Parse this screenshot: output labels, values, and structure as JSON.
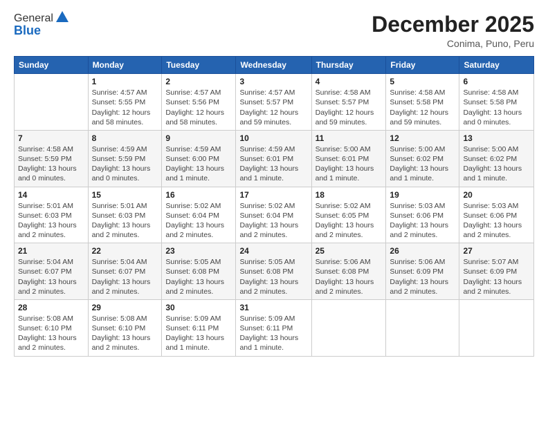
{
  "header": {
    "logo": {
      "line1": "General",
      "line2": "Blue"
    },
    "title": "December 2025",
    "location": "Conima, Puno, Peru"
  },
  "calendar": {
    "days_of_week": [
      "Sunday",
      "Monday",
      "Tuesday",
      "Wednesday",
      "Thursday",
      "Friday",
      "Saturday"
    ],
    "weeks": [
      [
        {
          "day": "",
          "info": ""
        },
        {
          "day": "1",
          "info": "Sunrise: 4:57 AM\nSunset: 5:55 PM\nDaylight: 12 hours\nand 58 minutes."
        },
        {
          "day": "2",
          "info": "Sunrise: 4:57 AM\nSunset: 5:56 PM\nDaylight: 12 hours\nand 58 minutes."
        },
        {
          "day": "3",
          "info": "Sunrise: 4:57 AM\nSunset: 5:57 PM\nDaylight: 12 hours\nand 59 minutes."
        },
        {
          "day": "4",
          "info": "Sunrise: 4:58 AM\nSunset: 5:57 PM\nDaylight: 12 hours\nand 59 minutes."
        },
        {
          "day": "5",
          "info": "Sunrise: 4:58 AM\nSunset: 5:58 PM\nDaylight: 12 hours\nand 59 minutes."
        },
        {
          "day": "6",
          "info": "Sunrise: 4:58 AM\nSunset: 5:58 PM\nDaylight: 13 hours\nand 0 minutes."
        }
      ],
      [
        {
          "day": "7",
          "info": "Sunrise: 4:58 AM\nSunset: 5:59 PM\nDaylight: 13 hours\nand 0 minutes."
        },
        {
          "day": "8",
          "info": "Sunrise: 4:59 AM\nSunset: 5:59 PM\nDaylight: 13 hours\nand 0 minutes."
        },
        {
          "day": "9",
          "info": "Sunrise: 4:59 AM\nSunset: 6:00 PM\nDaylight: 13 hours\nand 1 minute."
        },
        {
          "day": "10",
          "info": "Sunrise: 4:59 AM\nSunset: 6:01 PM\nDaylight: 13 hours\nand 1 minute."
        },
        {
          "day": "11",
          "info": "Sunrise: 5:00 AM\nSunset: 6:01 PM\nDaylight: 13 hours\nand 1 minute."
        },
        {
          "day": "12",
          "info": "Sunrise: 5:00 AM\nSunset: 6:02 PM\nDaylight: 13 hours\nand 1 minute."
        },
        {
          "day": "13",
          "info": "Sunrise: 5:00 AM\nSunset: 6:02 PM\nDaylight: 13 hours\nand 1 minute."
        }
      ],
      [
        {
          "day": "14",
          "info": "Sunrise: 5:01 AM\nSunset: 6:03 PM\nDaylight: 13 hours\nand 2 minutes."
        },
        {
          "day": "15",
          "info": "Sunrise: 5:01 AM\nSunset: 6:03 PM\nDaylight: 13 hours\nand 2 minutes."
        },
        {
          "day": "16",
          "info": "Sunrise: 5:02 AM\nSunset: 6:04 PM\nDaylight: 13 hours\nand 2 minutes."
        },
        {
          "day": "17",
          "info": "Sunrise: 5:02 AM\nSunset: 6:04 PM\nDaylight: 13 hours\nand 2 minutes."
        },
        {
          "day": "18",
          "info": "Sunrise: 5:02 AM\nSunset: 6:05 PM\nDaylight: 13 hours\nand 2 minutes."
        },
        {
          "day": "19",
          "info": "Sunrise: 5:03 AM\nSunset: 6:06 PM\nDaylight: 13 hours\nand 2 minutes."
        },
        {
          "day": "20",
          "info": "Sunrise: 5:03 AM\nSunset: 6:06 PM\nDaylight: 13 hours\nand 2 minutes."
        }
      ],
      [
        {
          "day": "21",
          "info": "Sunrise: 5:04 AM\nSunset: 6:07 PM\nDaylight: 13 hours\nand 2 minutes."
        },
        {
          "day": "22",
          "info": "Sunrise: 5:04 AM\nSunset: 6:07 PM\nDaylight: 13 hours\nand 2 minutes."
        },
        {
          "day": "23",
          "info": "Sunrise: 5:05 AM\nSunset: 6:08 PM\nDaylight: 13 hours\nand 2 minutes."
        },
        {
          "day": "24",
          "info": "Sunrise: 5:05 AM\nSunset: 6:08 PM\nDaylight: 13 hours\nand 2 minutes."
        },
        {
          "day": "25",
          "info": "Sunrise: 5:06 AM\nSunset: 6:08 PM\nDaylight: 13 hours\nand 2 minutes."
        },
        {
          "day": "26",
          "info": "Sunrise: 5:06 AM\nSunset: 6:09 PM\nDaylight: 13 hours\nand 2 minutes."
        },
        {
          "day": "27",
          "info": "Sunrise: 5:07 AM\nSunset: 6:09 PM\nDaylight: 13 hours\nand 2 minutes."
        }
      ],
      [
        {
          "day": "28",
          "info": "Sunrise: 5:08 AM\nSunset: 6:10 PM\nDaylight: 13 hours\nand 2 minutes."
        },
        {
          "day": "29",
          "info": "Sunrise: 5:08 AM\nSunset: 6:10 PM\nDaylight: 13 hours\nand 2 minutes."
        },
        {
          "day": "30",
          "info": "Sunrise: 5:09 AM\nSunset: 6:11 PM\nDaylight: 13 hours\nand 1 minute."
        },
        {
          "day": "31",
          "info": "Sunrise: 5:09 AM\nSunset: 6:11 PM\nDaylight: 13 hours\nand 1 minute."
        },
        {
          "day": "",
          "info": ""
        },
        {
          "day": "",
          "info": ""
        },
        {
          "day": "",
          "info": ""
        }
      ]
    ]
  }
}
